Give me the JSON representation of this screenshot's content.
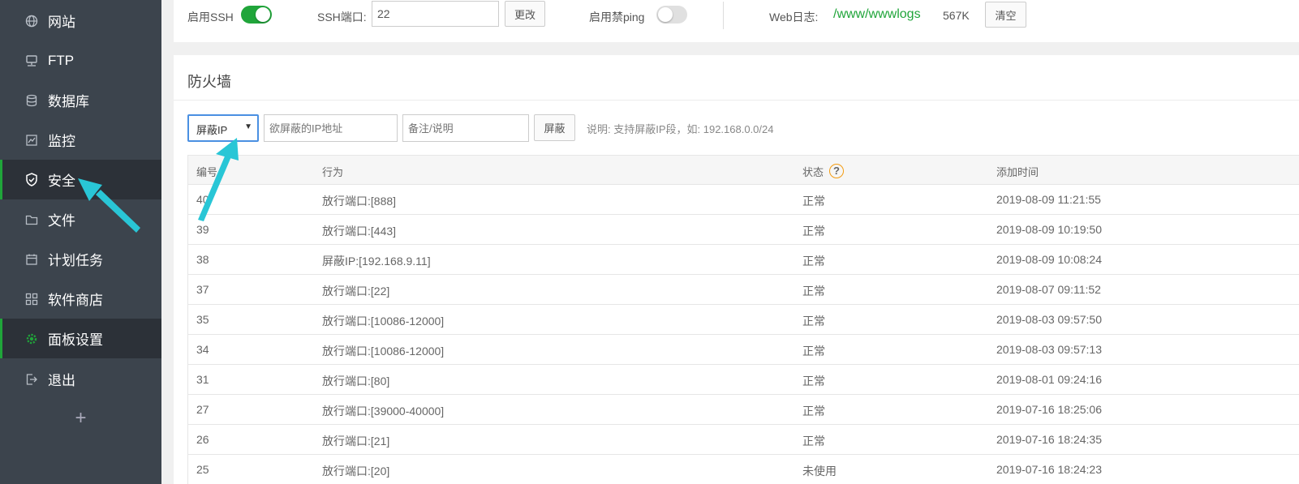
{
  "sidebar": {
    "items": [
      {
        "label": "网站",
        "icon": "globe-icon"
      },
      {
        "label": "FTP",
        "icon": "ftp-icon"
      },
      {
        "label": "数据库",
        "icon": "database-icon"
      },
      {
        "label": "监控",
        "icon": "monitor-icon"
      },
      {
        "label": "安全",
        "icon": "shield-icon"
      },
      {
        "label": "文件",
        "icon": "folder-icon"
      },
      {
        "label": "计划任务",
        "icon": "calendar-icon"
      },
      {
        "label": "软件商店",
        "icon": "grid-icon"
      },
      {
        "label": "面板设置",
        "icon": "gear-icon"
      },
      {
        "label": "退出",
        "icon": "logout-icon"
      }
    ],
    "add_label": "+"
  },
  "top": {
    "ssh_label": "启用SSH",
    "ssh_enabled": true,
    "ssh_port_label": "SSH端口:",
    "ssh_port_value": "22",
    "change_button": "更改",
    "ping_label": "启用禁ping",
    "ping_enabled": false,
    "weblog_label": "Web日志:",
    "weblog_path": "/www/wwwlogs",
    "weblog_size": "567K",
    "clear_button": "清空"
  },
  "firewall": {
    "title": "防火墙",
    "select_value": "屏蔽IP",
    "ip_placeholder": "欲屏蔽的IP地址",
    "note_placeholder": "备注/说明",
    "block_button": "屏蔽",
    "note": "说明: 支持屏蔽IP段，如: 192.168.0.0/24",
    "columns": [
      "编号",
      "行为",
      "状态",
      "添加时间"
    ],
    "help_icon": "?",
    "rows": [
      {
        "id": "40",
        "action": "放行端口:[888]",
        "status": "正常",
        "time": "2019-08-09 11:21:55"
      },
      {
        "id": "39",
        "action": "放行端口:[443]",
        "status": "正常",
        "time": "2019-08-09 10:19:50"
      },
      {
        "id": "38",
        "action": "屏蔽IP:[192.168.9.11]",
        "status": "正常",
        "time": "2019-08-09 10:08:24"
      },
      {
        "id": "37",
        "action": "放行端口:[22]",
        "status": "正常",
        "time": "2019-08-07 09:11:52"
      },
      {
        "id": "35",
        "action": "放行端口:[10086-12000]",
        "status": "正常",
        "time": "2019-08-03 09:57:50"
      },
      {
        "id": "34",
        "action": "放行端口:[10086-12000]",
        "status": "正常",
        "time": "2019-08-03 09:57:13"
      },
      {
        "id": "31",
        "action": "放行端口:[80]",
        "status": "正常",
        "time": "2019-08-01 09:24:16"
      },
      {
        "id": "27",
        "action": "放行端口:[39000-40000]",
        "status": "正常",
        "time": "2019-07-16 18:25:06"
      },
      {
        "id": "26",
        "action": "放行端口:[21]",
        "status": "正常",
        "time": "2019-07-16 18:24:35"
      },
      {
        "id": "25",
        "action": "放行端口:[20]",
        "status": "未使用",
        "time": "2019-07-16 18:24:23"
      }
    ]
  },
  "colors": {
    "accent": "#20a53a",
    "sidebar": "#3c444d",
    "arrow": "#29c6d6"
  }
}
